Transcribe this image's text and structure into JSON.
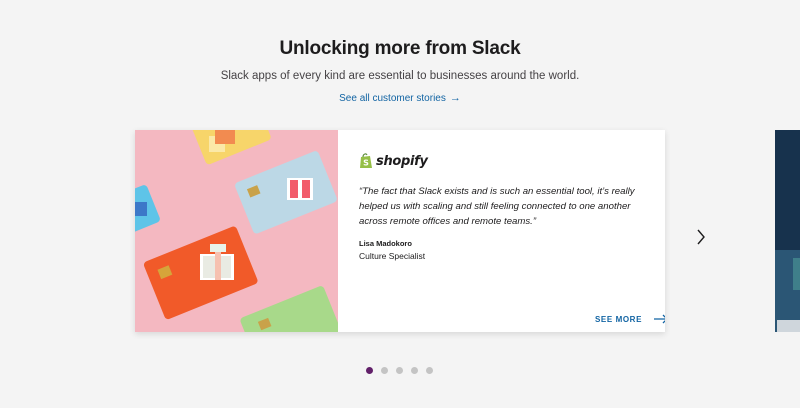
{
  "section": {
    "title": "Unlocking more from Slack",
    "subtitle": "Slack apps of every kind are essential to businesses around the world.",
    "stories_link": "See all customer stories",
    "stories_link_arrow": "→"
  },
  "card": {
    "brand": "shopify",
    "brand_icon": "shopify-bag-icon",
    "quote": "“The fact that Slack exists and is such an essential tool, it’s really helped us with scaling and still feeling connected to one another across remote offices and remote teams.”",
    "author_name": "Lisa Madokoro",
    "author_title": "Culture Specialist",
    "see_more": "SEE MORE"
  },
  "carousel": {
    "slides": 5,
    "active_index": 0
  },
  "colors": {
    "link": "#1264a3",
    "active_dot": "#611f69",
    "inactive_dot": "#c4c4c4",
    "shopify_green": "#95bf47",
    "image_bg": "#f4b8c1"
  }
}
